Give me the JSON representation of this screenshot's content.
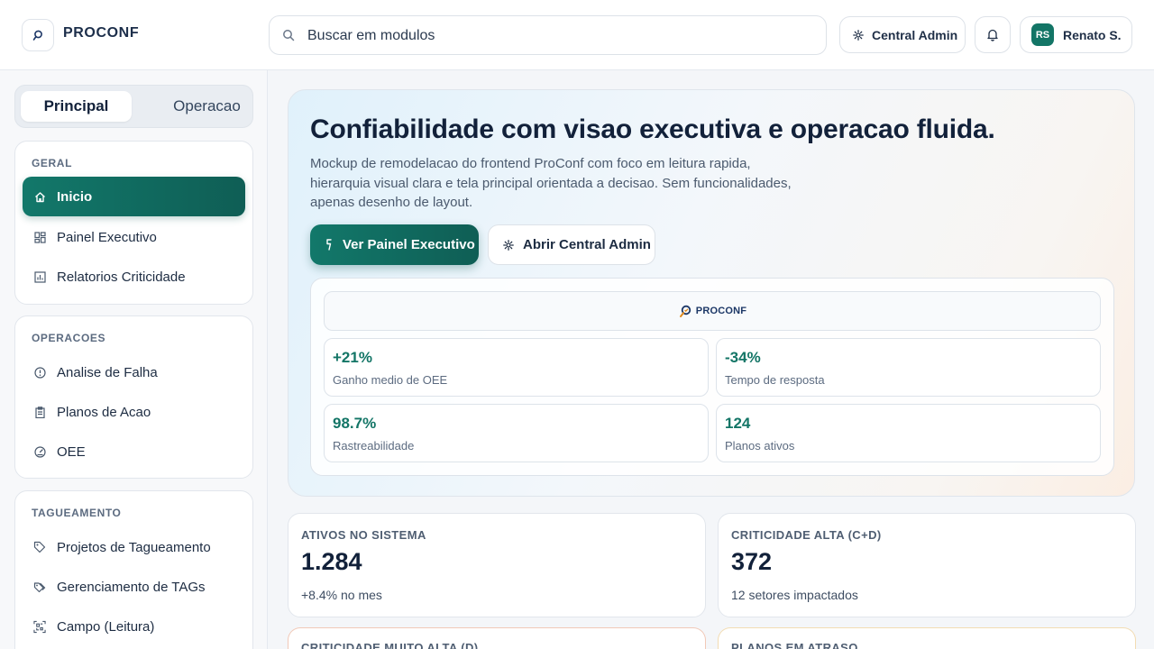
{
  "brand": {
    "name": "PROCONF"
  },
  "search": {
    "placeholder": "Buscar em modulos"
  },
  "header": {
    "admin_label": "Central Admin",
    "user_initials": "RS",
    "user_name": "Renato S."
  },
  "sidebar": {
    "tabs": [
      {
        "label": "Principal",
        "active": true
      },
      {
        "label": "Operacao",
        "active": false
      }
    ],
    "sections": [
      {
        "title": "GERAL",
        "items": [
          {
            "label": "Inicio",
            "icon": "home-icon",
            "active": true
          },
          {
            "label": "Painel Executivo",
            "icon": "dashboard-icon"
          },
          {
            "label": "Relatorios Criticidade",
            "icon": "bar-chart-icon"
          }
        ]
      },
      {
        "title": "OPERACOES",
        "items": [
          {
            "label": "Analise de Falha",
            "icon": "alert-circle-icon"
          },
          {
            "label": "Planos de Acao",
            "icon": "clipboard-icon"
          },
          {
            "label": "OEE",
            "icon": "gauge-icon"
          }
        ]
      },
      {
        "title": "TAGUEAMENTO",
        "items": [
          {
            "label": "Projetos de Tagueamento",
            "icon": "tag-icon"
          },
          {
            "label": "Gerenciamento de TAGs",
            "icon": "tags-icon"
          },
          {
            "label": "Campo (Leitura)",
            "icon": "qr-scan-icon"
          }
        ]
      }
    ]
  },
  "hero": {
    "title": "Confiabilidade com visao executiva e operacao fluida.",
    "subtitle": "Mockup de remodelacao do frontend ProConf com foco em leitura rapida, hierarquia visual clara e tela principal orientada a decisao. Sem funcionalidades, apenas desenho de layout.",
    "primary_button": "Ver Painel Executivo",
    "secondary_button": "Abrir Central Admin",
    "preview_logo": "PROCONF",
    "stats": [
      {
        "value": "+21%",
        "label": "Ganho medio de OEE"
      },
      {
        "value": "-34%",
        "label": "Tempo de resposta"
      },
      {
        "value": "98.7%",
        "label": "Rastreabilidade"
      },
      {
        "value": "124",
        "label": "Planos ativos"
      }
    ]
  },
  "kpis": [
    {
      "title": "ATIVOS NO SISTEMA",
      "value": "1.284",
      "detail": "+8.4% no mes"
    },
    {
      "title": "CRITICIDADE ALTA (C+D)",
      "value": "372",
      "detail": "12 setores impactados"
    },
    {
      "title": "CRITICIDADE MUITO ALTA (D)"
    },
    {
      "title": "PLANOS EM ATRASO"
    }
  ],
  "colors": {
    "accent": "#137566",
    "accent_dark": "#0f5e55",
    "text_dark": "#12213a"
  }
}
